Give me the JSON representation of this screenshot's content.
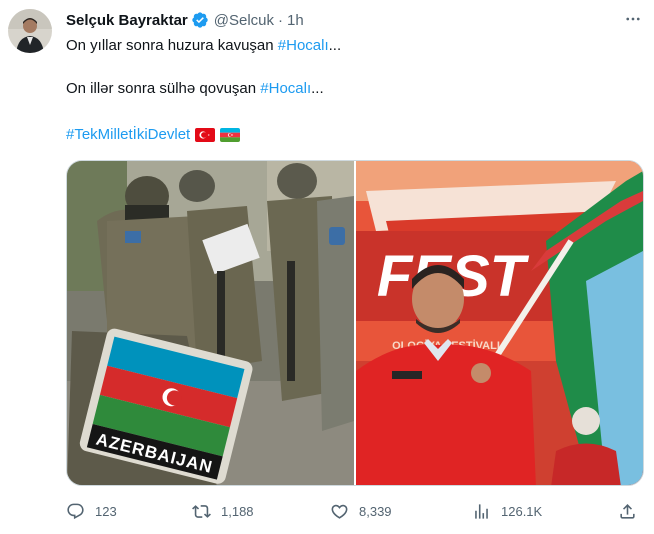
{
  "author": {
    "display_name": "Selçuk Bayraktar",
    "handle": "@Selcuk",
    "separator": "·",
    "time": "1h",
    "verified": true
  },
  "tweet": {
    "line1_text": "On yıllar sonra huzura kavuşan ",
    "line1_hashtag": "#Hocalı",
    "line1_suffix": "...",
    "line2_text": "On illər sonra sülhə qovuşan ",
    "line2_hashtag": "#Hocalı",
    "line2_suffix": "...",
    "line3_hashtag": "#TekMilletİkiDevlet",
    "flags": [
      "turkey-flag",
      "azerbaijan-flag"
    ]
  },
  "media": {
    "left_photo": "soldiers-with-azerbaijan-patch",
    "right_photo": "man-holding-azerbaijan-flag",
    "patch_text": "AZERBAIJAN",
    "banner_text": "FEST",
    "banner_subtext": "OLOGİYA FESTİVALI"
  },
  "actions": {
    "replies": "123",
    "reposts": "1,188",
    "likes": "8,339",
    "views": "126.1K"
  },
  "colors": {
    "link": "#1d9bf0",
    "secondary": "#536471",
    "verified": "#1d9bf0"
  }
}
